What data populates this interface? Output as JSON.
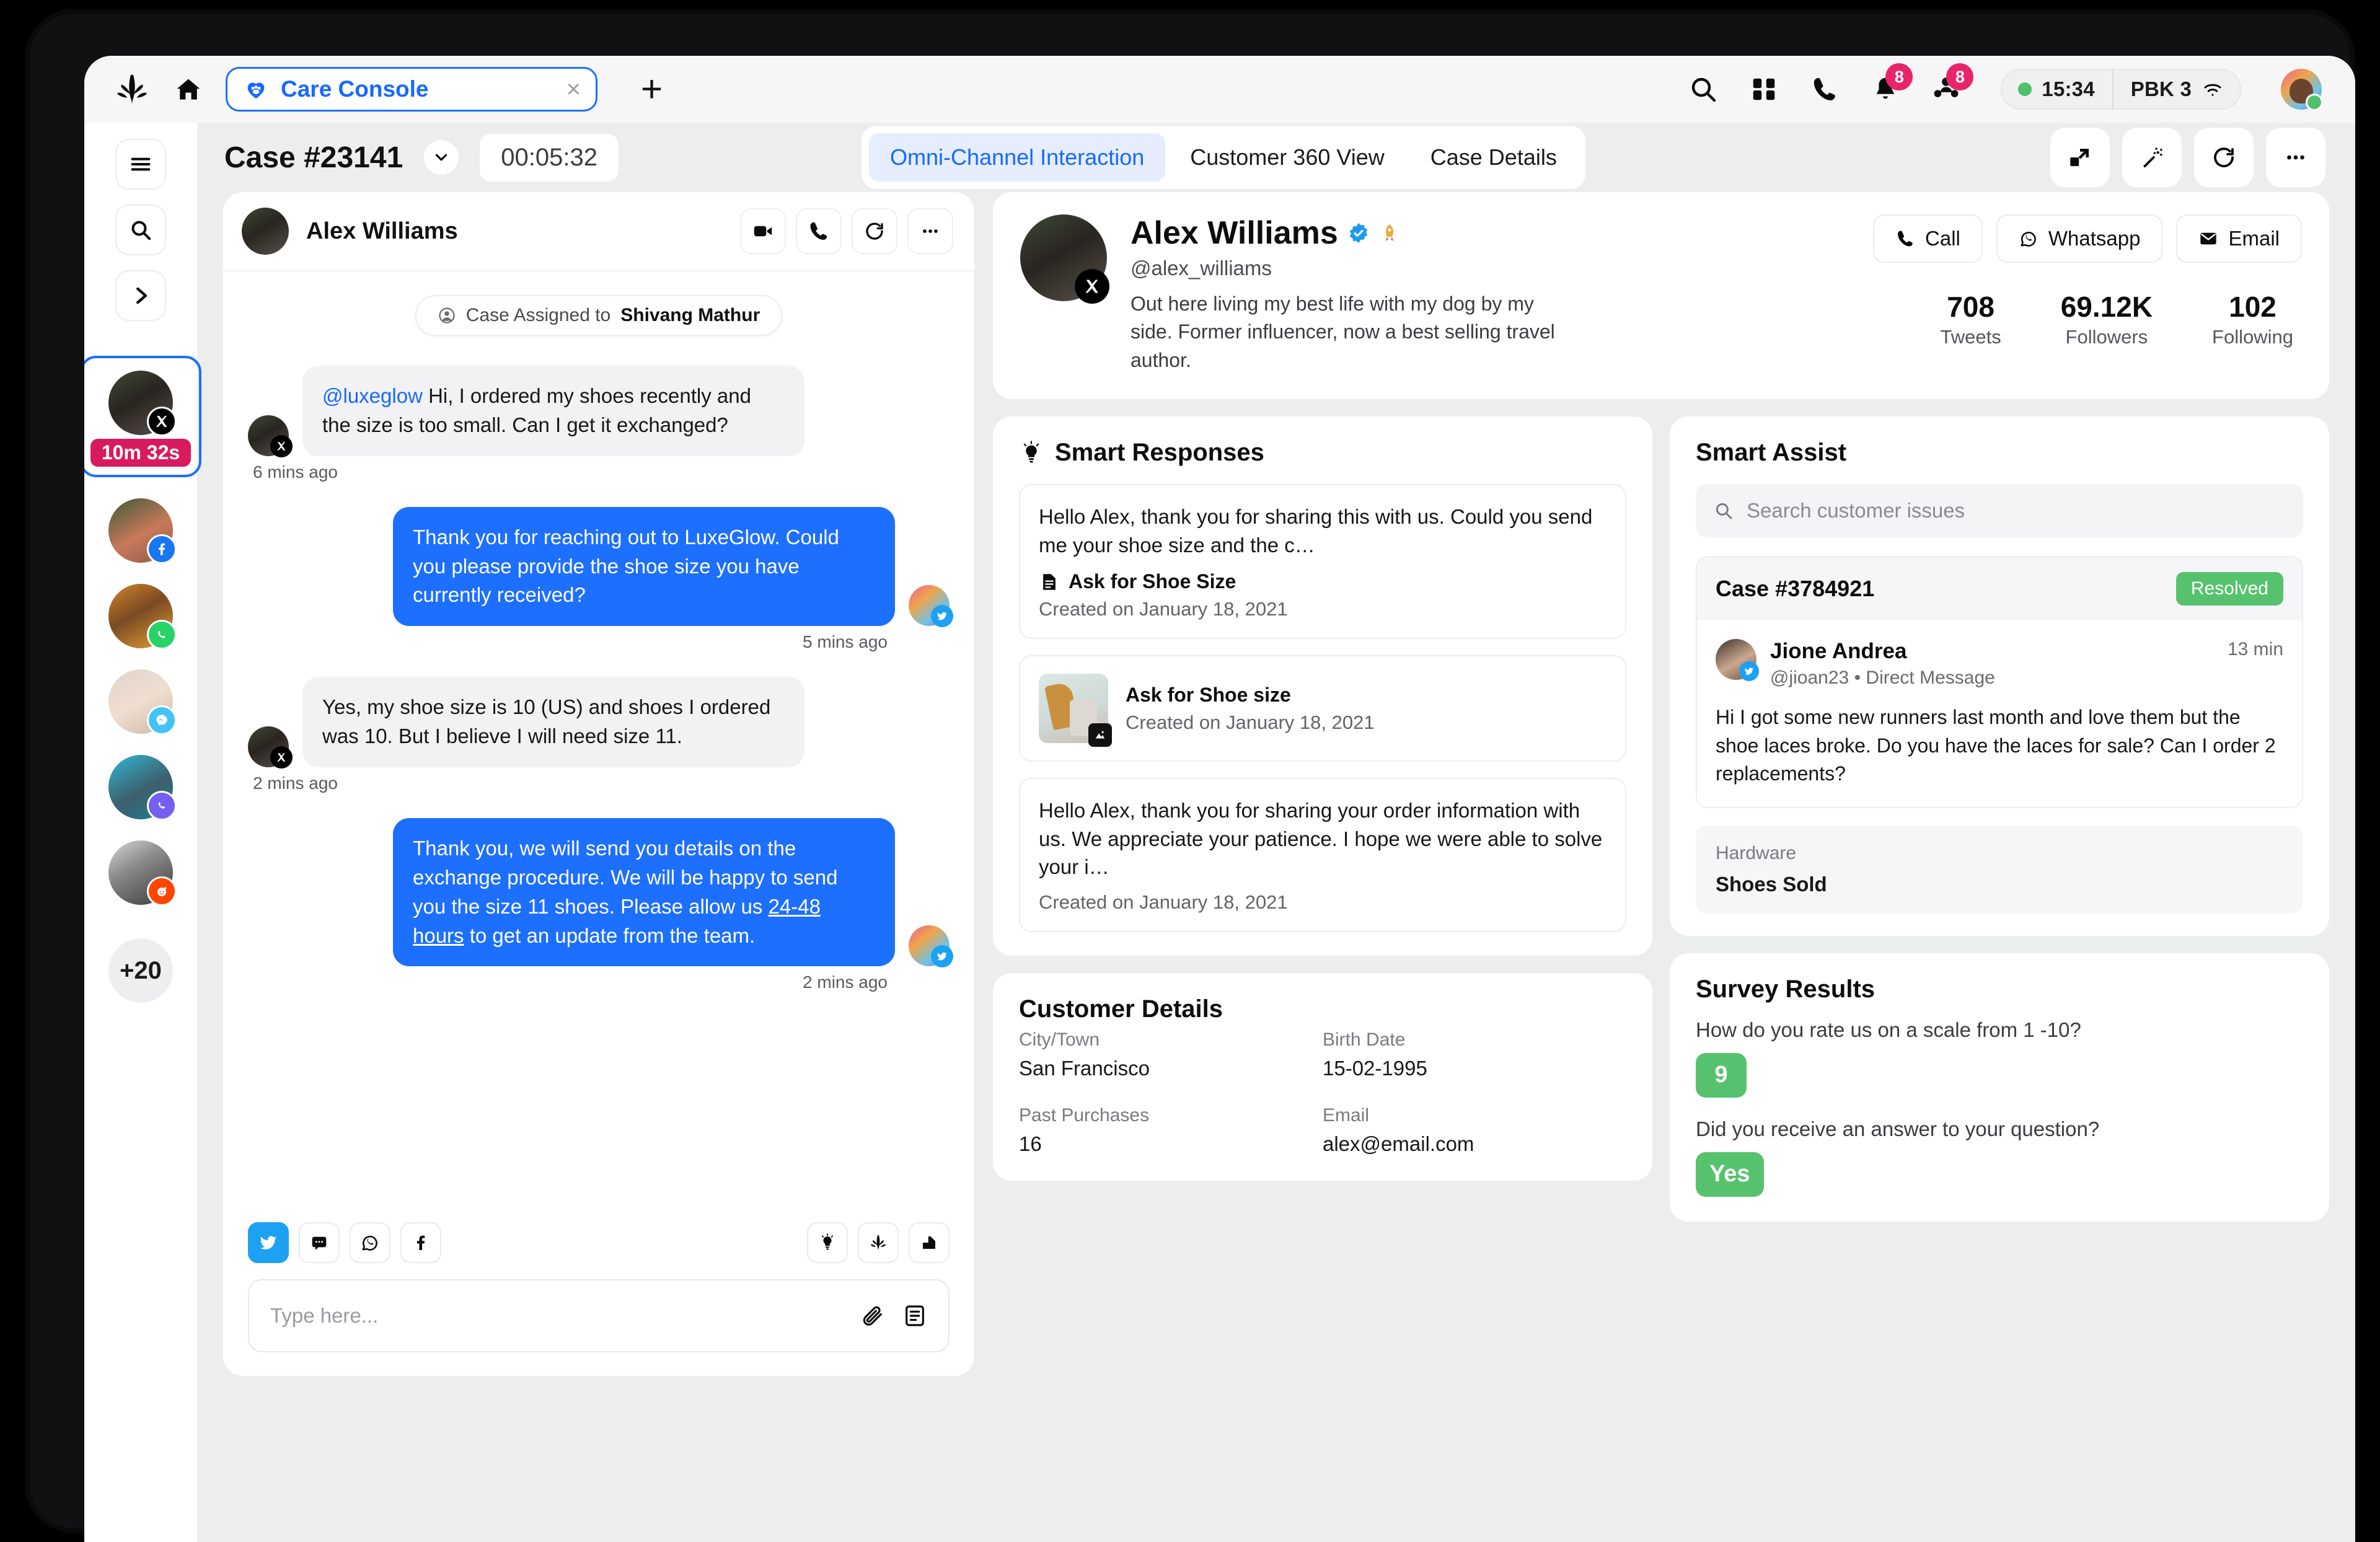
{
  "browser": {
    "brand_icon": "sprinklr-logo-icon",
    "home_icon": "home-icon",
    "tab": {
      "icon": "care-heart-icon",
      "label": "Care Console",
      "close_icon": "close-icon"
    },
    "new_tab_label": "+",
    "icons": [
      "search-icon",
      "apps-grid-icon",
      "phone-icon",
      "bell-icon",
      "group-icon"
    ],
    "notification_badges": {
      "bell": "8",
      "group": "8"
    },
    "status": {
      "dot_color": "#4ec16b",
      "time": "15:34",
      "device": "PBK 3",
      "wifi_icon": "wifi-icon"
    }
  },
  "rail": {
    "buttons": [
      "menu-icon",
      "search-icon",
      "chevron-right-icon"
    ],
    "queue": [
      {
        "channel": "x",
        "active": true,
        "timer": "10m 32s"
      },
      {
        "channel": "facebook",
        "active": false
      },
      {
        "channel": "whatsapp",
        "active": false
      },
      {
        "channel": "messenger",
        "active": false
      },
      {
        "channel": "viber",
        "active": false
      },
      {
        "channel": "reddit",
        "active": false
      }
    ],
    "more_label": "+20"
  },
  "workspace": {
    "case_title": "Case #23141",
    "chevron_icon": "chevron-down-icon",
    "timer": "00:05:32",
    "tabs": [
      {
        "label": "Omni-Channel Interaction",
        "active": true
      },
      {
        "label": "Customer 360 View",
        "active": false
      },
      {
        "label": "Case Details",
        "active": false
      }
    ],
    "actions": [
      "transfer-icon",
      "magic-wand-icon",
      "refresh-icon",
      "more-horizontal-icon"
    ]
  },
  "conversation": {
    "header": {
      "name": "Alex Williams",
      "actions": [
        "video-camera-icon",
        "phone-icon",
        "refresh-icon",
        "more-horizontal-icon"
      ]
    },
    "assignment": {
      "icon": "user-circle-icon",
      "prefix": "Case Assigned to ",
      "assignee": "Shivang Mathur"
    },
    "messages": [
      {
        "direction": "in",
        "channel": "x",
        "mention": "@luxeglow",
        "text": " Hi, I ordered my shoes recently and the size is too small. Can I get it exchanged?",
        "time": "6 mins ago"
      },
      {
        "direction": "out",
        "channel": "twitter",
        "text": "Thank you for reaching out to LuxeGlow. Could you please provide the shoe size you have currently received?",
        "time": "5 mins ago"
      },
      {
        "direction": "in",
        "channel": "x",
        "text": "Yes, my shoe size is 10 (US) and shoes I ordered was 10. But I believe I will need size 11.",
        "time": "2 mins ago"
      },
      {
        "direction": "out",
        "channel": "twitter",
        "text_before": "Thank you, we will send you details on the exchange procedure. We will be happy to send you the size 11 shoes. Please allow us ",
        "text_link": "24-48 hours",
        "text_after": " to get an update from the team.",
        "time": "2 mins ago"
      }
    ],
    "composer": {
      "channels": [
        {
          "name": "twitter-icon",
          "active": true
        },
        {
          "name": "messenger-icon",
          "active": false
        },
        {
          "name": "whatsapp-icon",
          "active": false
        },
        {
          "name": "facebook-icon",
          "active": false
        }
      ],
      "tools": [
        "lightbulb-icon",
        "sprinklr-logo-icon",
        "knowledge-base-icon"
      ],
      "placeholder": "Type here...",
      "input_value": "",
      "input_tools": [
        "attachment-icon",
        "template-icon"
      ]
    }
  },
  "profile": {
    "name": "Alex Williams",
    "verified_icon": "verified-badge-icon",
    "award_icon": "rocket-icon",
    "handle": "@alex_williams",
    "bio": "Out here living my best life with my dog by my side. Former influencer, now a best selling travel author.",
    "channel_badge": "x-icon",
    "buttons": [
      {
        "icon": "phone-icon",
        "label": "Call"
      },
      {
        "icon": "whatsapp-icon",
        "label": "Whatsapp"
      },
      {
        "icon": "email-icon",
        "label": "Email"
      }
    ],
    "stats": [
      {
        "value": "708",
        "label": "Tweets"
      },
      {
        "value": "69.12K",
        "label": "Followers"
      },
      {
        "value": "102",
        "label": "Following"
      }
    ]
  },
  "smart_responses": {
    "icon": "lightbulb-icon",
    "title": "Smart Responses",
    "items": [
      {
        "type": "text",
        "text": "Hello Alex, thank you for sharing this with us. Could you send me your shoe size and the c…",
        "doc_icon": "document-icon",
        "name": "Ask for Shoe Size",
        "date": "Created on January 18, 2021"
      },
      {
        "type": "media",
        "thumb": "shoes-thumbnail",
        "badge_icon": "image-icon",
        "name": "Ask for Shoe size",
        "date": "Created on January 18, 2021"
      },
      {
        "type": "text",
        "text": "Hello Alex, thank you for sharing your order information with us. We appreciate your patience. I hope we were able to solve your i…",
        "date": "Created on January 18, 2021"
      }
    ]
  },
  "customer_details": {
    "title": "Customer Details",
    "fields": [
      {
        "label": "City/Town",
        "value": "San Francisco"
      },
      {
        "label": "Birth Date",
        "value": "15-02-1995"
      },
      {
        "label": "Past Purchases",
        "value": "16"
      },
      {
        "label": "Email",
        "value": "alex@email.com"
      }
    ]
  },
  "smart_assist": {
    "title": "Smart Assist",
    "search": {
      "icon": "search-icon",
      "placeholder": "Search customer issues",
      "value": ""
    },
    "case": {
      "id": "Case #3784921",
      "status": "Resolved",
      "status_color": "#57c26e",
      "person": {
        "name": "Jione Andrea",
        "handle": "@jioan23",
        "separator": "•",
        "source": "Direct Message",
        "channel": "twitter-icon"
      },
      "time": "13 min",
      "message": "Hi I got some new runners last month and love them but the shoe laces broke. Do you have the laces for sale? Can I order 2 replacements?"
    },
    "hardware": {
      "label": "Hardware",
      "value": "Shoes Sold"
    }
  },
  "survey": {
    "title": "Survey Results",
    "items": [
      {
        "question": "How do you rate us on a scale from 1 -10?",
        "answer": "9"
      },
      {
        "question": "Did you receive an answer to your question?",
        "answer": "Yes"
      }
    ]
  }
}
